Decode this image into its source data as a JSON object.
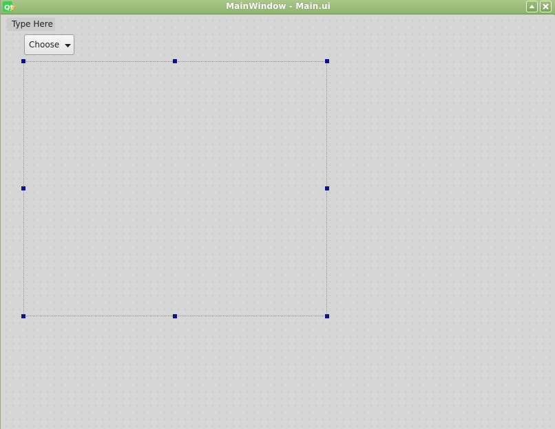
{
  "window": {
    "title": "MainWindow - Main.ui",
    "app_icon": "qt-designer-icon",
    "buttons": [
      "maximize-icon",
      "close-icon"
    ]
  },
  "menubar": {
    "placeholder_label": "Type Here"
  },
  "combo": {
    "selected": "Choose",
    "icon": "dropdown-arrow-icon"
  },
  "colors": {
    "titlebar": "#8fb46c",
    "canvas": "#d6d6d6",
    "handle": "#101091"
  }
}
